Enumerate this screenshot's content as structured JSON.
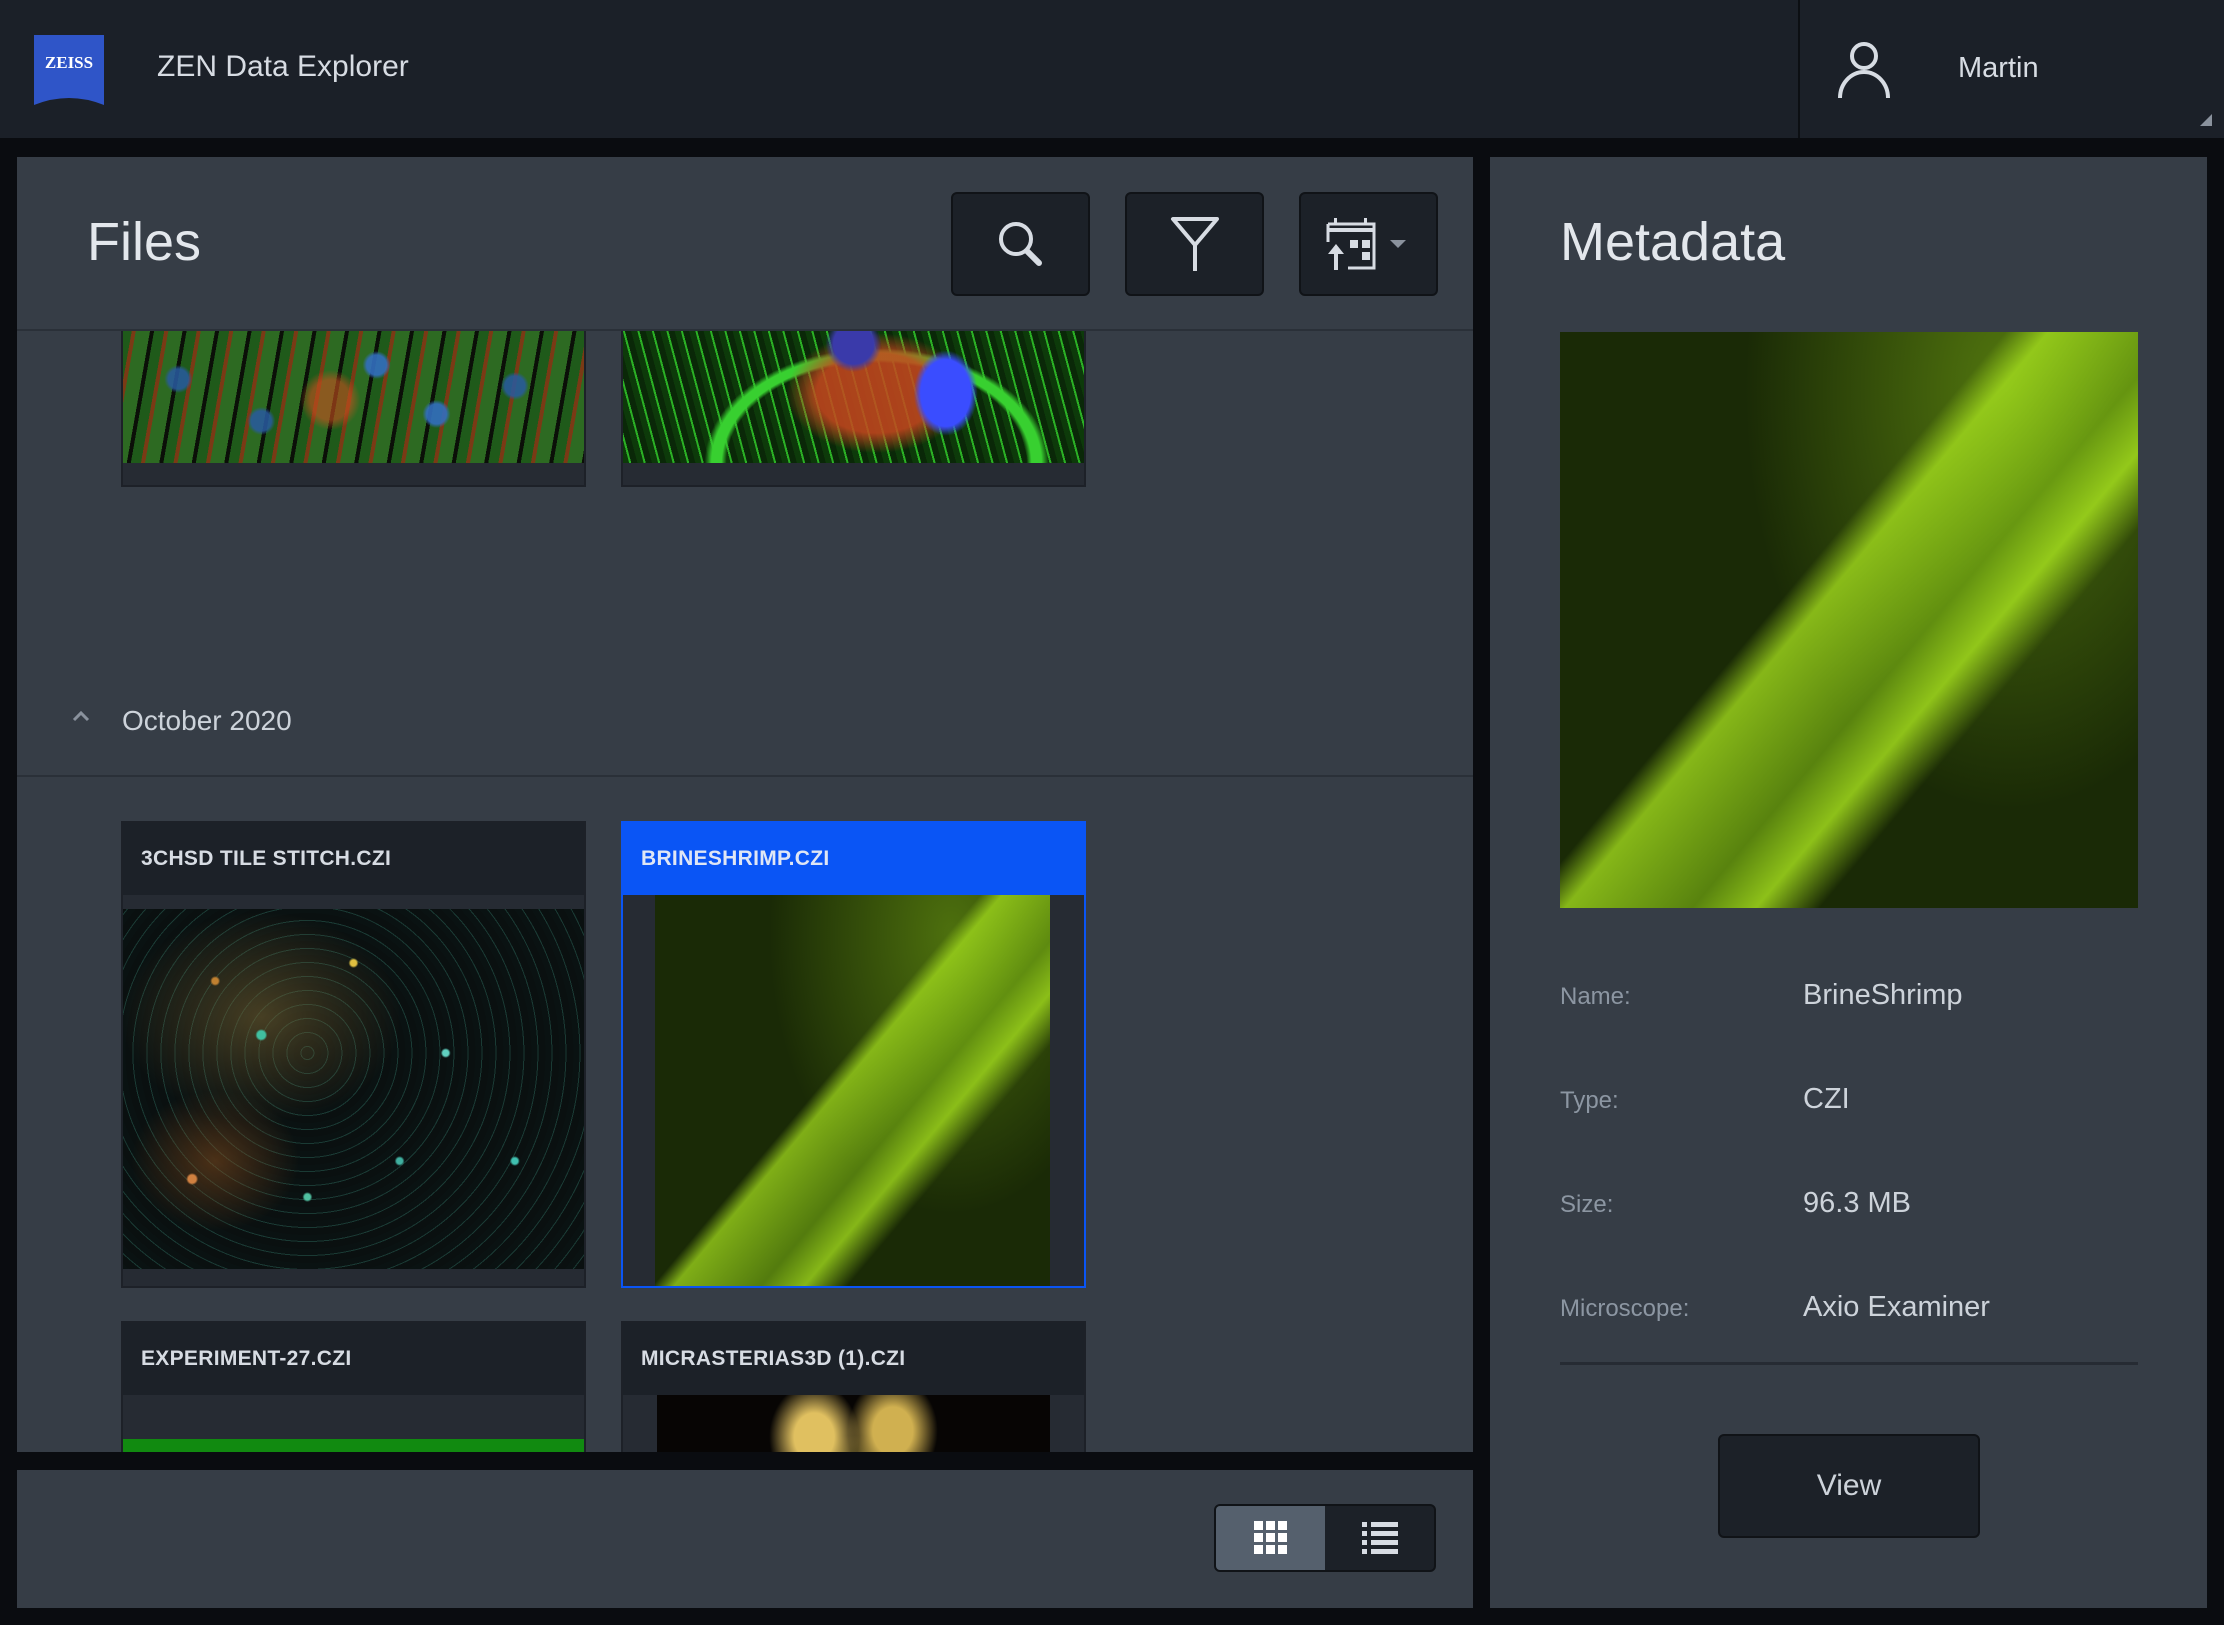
{
  "app": {
    "brand": "ZEISS",
    "title": "ZEN Data Explorer",
    "brand_color": "#2f55c8"
  },
  "user": {
    "name": "Martin",
    "icon": "user-icon"
  },
  "files": {
    "title": "Files",
    "toolbar": {
      "search_icon": "search-icon",
      "filter_icon": "filter-icon",
      "sort_icon": "calendar-sort-icon"
    },
    "groups": [
      {
        "label": "",
        "collapsed": false,
        "items": [
          {
            "name": "",
            "thumbnail": "multicolor-cells"
          },
          {
            "name": "",
            "thumbnail": "green-fibers-blue-nucleus"
          }
        ]
      },
      {
        "label": "October 2020",
        "collapsed": false,
        "items": [
          {
            "name": "3CHSD TILE STITCH.CZI",
            "thumbnail": "scattered-cells",
            "selected": false
          },
          {
            "name": "BRINESHRIMP.CZI",
            "thumbnail": "green-brineshrimp",
            "selected": true
          },
          {
            "name": "EXPERIMENT-27.CZI",
            "thumbnail": "green-tissue",
            "selected": false
          },
          {
            "name": "MICRASTERIAS3D (1).CZI",
            "thumbnail": "yellow-micrasterias",
            "selected": false
          }
        ]
      }
    ],
    "view_modes": [
      {
        "name": "grid",
        "icon": "grid-icon",
        "active": true
      },
      {
        "name": "list",
        "icon": "list-icon",
        "active": false
      }
    ],
    "selection_color": "#0a55f5"
  },
  "metadata": {
    "title": "Metadata",
    "fields": [
      {
        "label": "Name:",
        "value": "BrineShrimp"
      },
      {
        "label": "Type:",
        "value": "CZI"
      },
      {
        "label": "Size:",
        "value": "96.3 MB"
      },
      {
        "label": "Microscope:",
        "value": "Axio Examiner"
      }
    ],
    "view_button": "View"
  }
}
